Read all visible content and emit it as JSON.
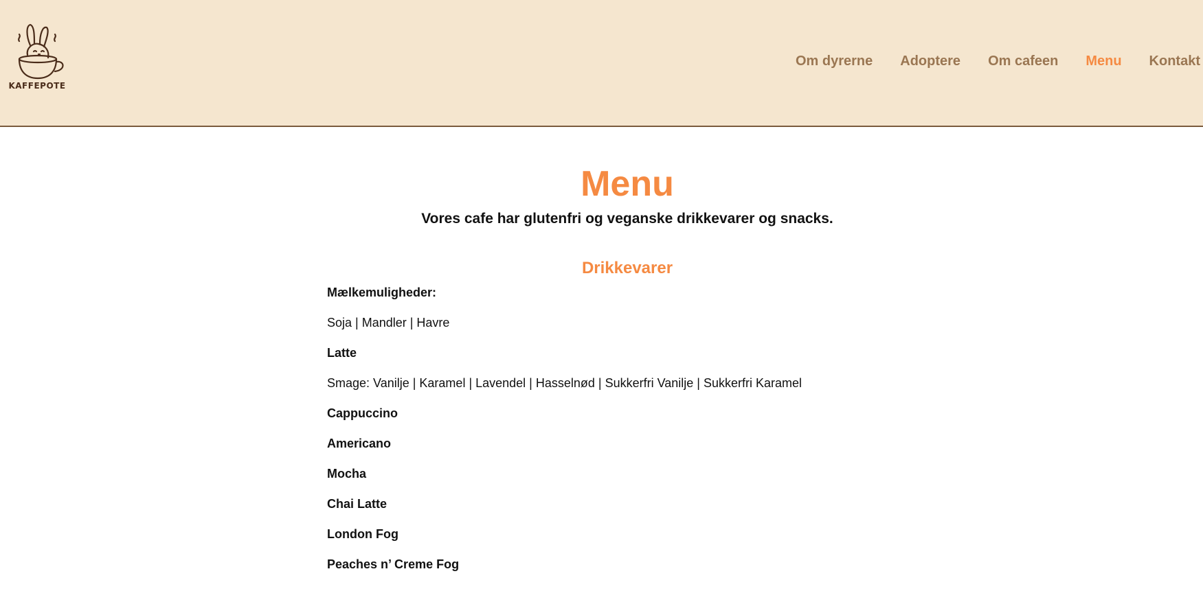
{
  "header": {
    "logo_text": "KAFFEPOTE",
    "nav": [
      {
        "label": "Om dyrerne",
        "active": false
      },
      {
        "label": "Adoptere",
        "active": false
      },
      {
        "label": "Om cafeen",
        "active": false
      },
      {
        "label": "Menu",
        "active": true
      },
      {
        "label": "Kontakt",
        "active": false
      }
    ]
  },
  "main": {
    "title": "Menu",
    "subtitle": "Vores cafe har glutenfri og veganske drikkevarer og snacks.",
    "section_title": "Drikkevarer",
    "lines": [
      {
        "text": "Mælkemuligheder:",
        "bold": true
      },
      {
        "text": "Soja | Mandler | Havre",
        "bold": false
      },
      {
        "text": "Latte",
        "bold": true
      },
      {
        "text": "Smage: Vanilje | Karamel | Lavendel | Hasselnød | Sukkerfri Vanilje | Sukkerfri Karamel",
        "bold": false
      },
      {
        "text": "Cappuccino",
        "bold": true
      },
      {
        "text": "Americano",
        "bold": true
      },
      {
        "text": "Mocha",
        "bold": true
      },
      {
        "text": "Chai Latte",
        "bold": true
      },
      {
        "text": "London Fog",
        "bold": true
      },
      {
        "text": "Peaches n’ Creme Fog",
        "bold": true
      }
    ]
  },
  "colors": {
    "header_bg": "#f5e6cf",
    "accent": "#f58a42",
    "nav_text": "#9a7652",
    "logo_brown": "#4a2c1a"
  }
}
